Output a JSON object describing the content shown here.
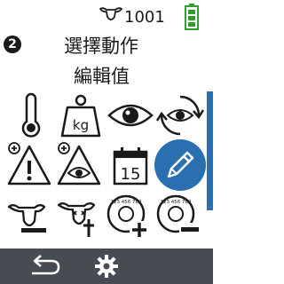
{
  "status": {
    "count": "1001",
    "cow_icon": "cow-head-icon",
    "battery_icon": "battery-icon",
    "battery_color": "#2e9f2e"
  },
  "header": {
    "step": "2",
    "title_line1": "選擇動作",
    "title_line2": "編輯值"
  },
  "grid": {
    "icons": [
      {
        "name": "thermometer-icon"
      },
      {
        "name": "weight-kg-icon",
        "label": "kg"
      },
      {
        "name": "eye-icon"
      },
      {
        "name": "eye-refresh-icon"
      },
      {
        "name": "warning-plus-icon"
      },
      {
        "name": "eye-warning-plus-icon"
      },
      {
        "name": "calendar-icon",
        "label": "15"
      },
      {
        "name": "pencil-edit-icon",
        "selected": true
      },
      {
        "name": "cow-remove-icon"
      },
      {
        "name": "cow-death-icon"
      },
      {
        "name": "eartag-add-icon",
        "label": "123 456 789"
      },
      {
        "name": "eartag-remove-icon",
        "label": "123 456 789"
      }
    ],
    "selected_color": "#2a6fb0"
  },
  "footer": {
    "back_icon": "back-arrow-icon",
    "settings_icon": "gear-icon",
    "bg_color": "#474b52"
  }
}
